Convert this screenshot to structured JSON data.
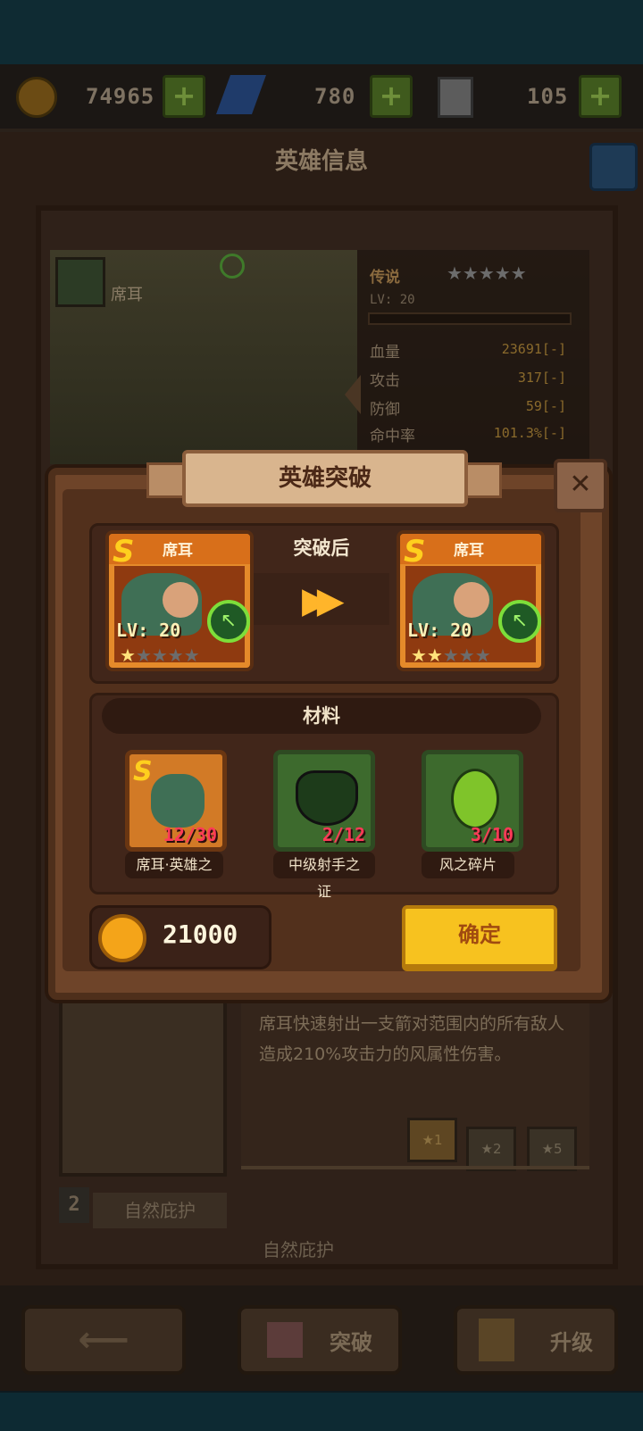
{
  "resources": {
    "gold": "74965",
    "gems": "780",
    "energy": "105"
  },
  "background": {
    "title": "英雄信息",
    "hero_name": "席耳",
    "rarity": "传说",
    "level": "LV: 20",
    "stats": [
      {
        "label": "血量",
        "value": "23691[-]"
      },
      {
        "label": "攻击",
        "value": "317[-]"
      },
      {
        "label": "防御",
        "value": "59[-]"
      },
      {
        "label": "命中率",
        "value": "101.3%[-]"
      }
    ],
    "skill_desc": "席耳快速射出一支箭对范围内的所有敌人造成210%攻击力的风属性伤害。",
    "skill_badges": [
      "★1",
      "★2",
      "★5"
    ],
    "skill2_level": "2",
    "skill2_label": "自然庇护",
    "skill2_name": "自然庇护"
  },
  "modal": {
    "title": "英雄突破",
    "close": "✕",
    "after_label": "突破后",
    "before_card": {
      "name": "席耳",
      "level": "LV: 20",
      "stars_on": 1,
      "stars_total": 5
    },
    "after_card": {
      "name": "席耳",
      "level": "LV: 20",
      "stars_on": 2,
      "stars_total": 5
    },
    "materials_title": "材料",
    "materials": [
      {
        "name": "席耳·英雄之",
        "count": "12/30",
        "icon": "hero-shard-icon"
      },
      {
        "name": "中级射手之证",
        "count": "2/12",
        "icon": "archer-crest-icon"
      },
      {
        "name": "风之碎片",
        "count": "3/10",
        "icon": "wind-shard-icon"
      }
    ],
    "cost": "21000",
    "confirm_label": "确定"
  },
  "bottom_nav": {
    "breakthrough": "突破",
    "upgrade": "升级"
  },
  "colors": {
    "accent_gold": "#f7c21f",
    "card_orange": "#e58a2a",
    "count_red": "#ff3a57"
  }
}
